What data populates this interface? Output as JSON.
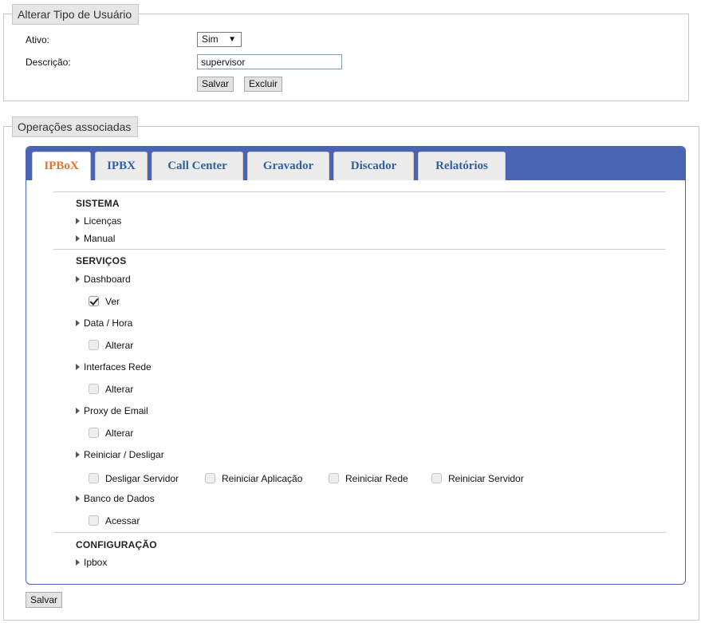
{
  "user_type_form": {
    "legend": "Alterar Tipo de Usuário",
    "active_label": "Ativo:",
    "active_value": "Sim",
    "description_label": "Descrição:",
    "description_value": "supervisor",
    "save_label": "Salvar",
    "delete_label": "Excluir"
  },
  "operations": {
    "legend": "Operações associadas",
    "tabs": [
      "IPBoX",
      "IPBX",
      "Call Center",
      "Gravador",
      "Discador",
      "Relatórios"
    ],
    "active_tab": "IPBoX",
    "sections": {
      "sistema": {
        "title": "SISTEMA",
        "items": [
          "Licenças",
          "Manual"
        ]
      },
      "servicos": {
        "title": "SERVIÇOS",
        "dashboard": {
          "label": "Dashboard",
          "perm": {
            "label": "Ver",
            "checked": true
          }
        },
        "data_hora": {
          "label": "Data / Hora",
          "perm": {
            "label": "Alterar",
            "checked": false
          }
        },
        "interfaces": {
          "label": "Interfaces Rede",
          "perm": {
            "label": "Alterar",
            "checked": false
          }
        },
        "proxy": {
          "label": "Proxy de Email",
          "perm": {
            "label": "Alterar",
            "checked": false
          }
        },
        "reiniciar": {
          "label": "Reiniciar / Desligar",
          "perms": [
            {
              "label": "Desligar Servidor",
              "checked": false
            },
            {
              "label": "Reiniciar Aplicação",
              "checked": false
            },
            {
              "label": "Reiniciar Rede",
              "checked": false
            },
            {
              "label": "Reiniciar Servidor",
              "checked": false
            }
          ]
        },
        "banco": {
          "label": "Banco de Dados",
          "perm": {
            "label": "Acessar",
            "checked": false
          }
        }
      },
      "configuracao": {
        "title": "CONFIGURAÇÃO",
        "items": [
          "Ipbox"
        ]
      }
    },
    "save_label": "Salvar"
  },
  "colors": {
    "tabbar": "#4a63b3",
    "active_tab_text": "#e0742a",
    "tab_text": "#2f5fa8"
  }
}
